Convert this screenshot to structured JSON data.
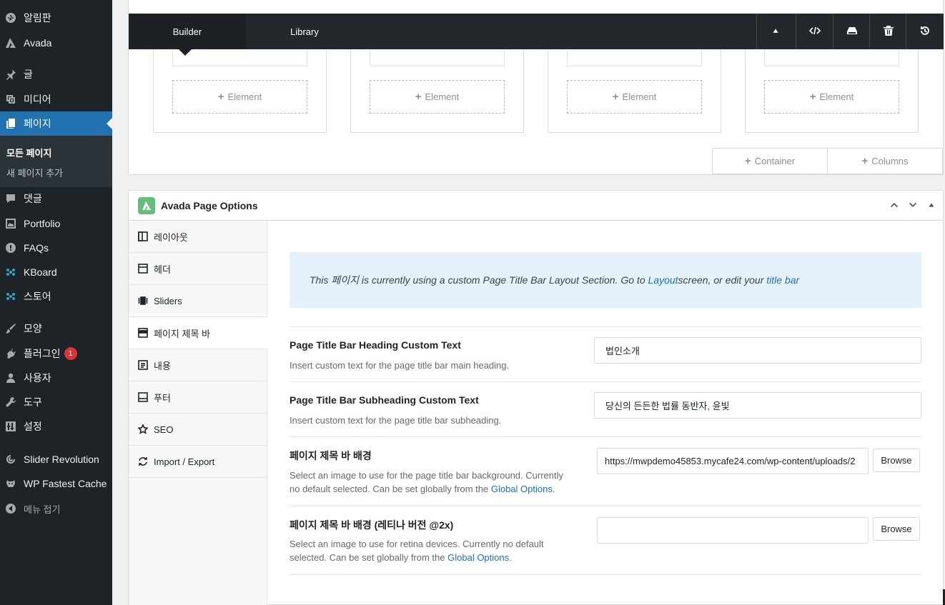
{
  "sidebar": {
    "items": [
      {
        "label": "알림판",
        "icon": "dashboard-icon"
      },
      {
        "label": "Avada",
        "icon": "avada-icon"
      },
      {
        "label": "글",
        "icon": "pin-icon"
      },
      {
        "label": "미디어",
        "icon": "media-icon"
      },
      {
        "label": "페이지",
        "icon": "pages-icon"
      },
      {
        "label": "댓글",
        "icon": "comments-icon"
      },
      {
        "label": "Portfolio",
        "icon": "portfolio-icon"
      },
      {
        "label": "FAQs",
        "icon": "faq-icon"
      },
      {
        "label": "KBoard",
        "icon": "kboard-icon"
      },
      {
        "label": "스토어",
        "icon": "store-icon"
      },
      {
        "label": "모양",
        "icon": "brush-icon"
      },
      {
        "label": "플러그인",
        "icon": "plugin-icon",
        "badge": "1"
      },
      {
        "label": "사용자",
        "icon": "user-icon"
      },
      {
        "label": "도구",
        "icon": "wrench-icon"
      },
      {
        "label": "설정",
        "icon": "settings-icon"
      },
      {
        "label": "Slider Revolution",
        "icon": "revslider-icon"
      },
      {
        "label": "WP Fastest Cache",
        "icon": "cheetah-icon"
      },
      {
        "label": "메뉴 접기",
        "icon": "collapse-icon"
      }
    ],
    "submenu": {
      "all_pages": "모든 페이지",
      "add_new": "새 페이지 추가"
    }
  },
  "builder": {
    "tabs": {
      "builder": "Builder",
      "library": "Library"
    },
    "add_element": "Element",
    "add_container": "Container",
    "add_columns": "Columns"
  },
  "page_options": {
    "title": "Avada Page Options",
    "nav": [
      {
        "label": "레이아웃",
        "icon": "layout-icon"
      },
      {
        "label": "헤더",
        "icon": "header-icon"
      },
      {
        "label": "Sliders",
        "icon": "sliders-icon"
      },
      {
        "label": "페이지 제목 바",
        "icon": "titlebar-icon"
      },
      {
        "label": "내용",
        "icon": "content-icon"
      },
      {
        "label": "푸터",
        "icon": "footer-icon"
      },
      {
        "label": "SEO",
        "icon": "star-icon"
      },
      {
        "label": "Import / Export",
        "icon": "import-export-icon"
      }
    ],
    "notice": {
      "part1": "This 페이지 is currently using a custom Page Title Bar Layout Section. Go to ",
      "link1": "Layout",
      "part2": " screen, or edit your ",
      "link2": "title bar"
    },
    "options": {
      "heading": {
        "label": "Page Title Bar Heading Custom Text",
        "desc": "Insert custom text for the page title bar main heading.",
        "value": "법인소개"
      },
      "subheading": {
        "label": "Page Title Bar Subheading Custom Text",
        "desc": "Insert custom text for the page title bar subheading.",
        "value": "당신의 든든한 법률 동반자, 윤빛"
      },
      "bg": {
        "label": "페이지 제목 바 배경",
        "desc": "Select an image to use for the page title bar background. Currently no default selected. Can be set globally from the ",
        "link": "Global Options",
        "value": "https://mwpdemo45853.mycafe24.com/wp-content/uploads/2",
        "browse": "Browse"
      },
      "bg_retina": {
        "label": "페이지 제목 바 배경 (레티나 버전 @2x)",
        "desc": "Select an image to use for retina devices. Currently no default selected. Can be set globally from the ",
        "link": "Global Options",
        "value": "",
        "browse": "Browse"
      }
    }
  },
  "colors": {
    "sidebar_bg": "#1d2327",
    "accent": "#2271b1",
    "avada_green": "#65bc7b",
    "notice_bg": "#e5f1fb"
  }
}
